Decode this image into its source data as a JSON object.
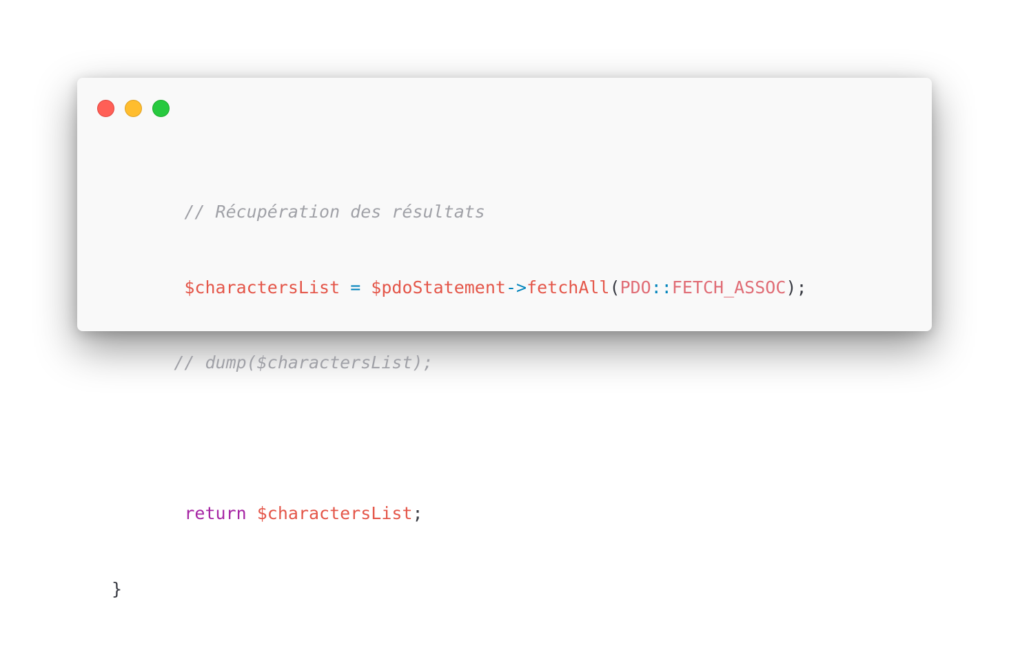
{
  "window": {
    "controls": [
      "close",
      "minimize",
      "maximize"
    ],
    "colors": {
      "background": "#f9f9f9",
      "close": "#ff5f56",
      "minimize": "#ffbd2e",
      "maximize": "#27c93f"
    }
  },
  "code": {
    "language": "php",
    "lines": [
      {
        "indent": "       ",
        "comment": "// Récupération des résultats"
      },
      {
        "indent": "       ",
        "var1": "$charactersList",
        "eq": " = ",
        "var2": "$pdoStatement",
        "arrow": "->",
        "method": "fetchAll",
        "open": "(",
        "cls": "PDO",
        "scope": "::",
        "constant": "FETCH_ASSOC",
        "close": ");"
      },
      {
        "indent": "      ",
        "comment": "// dump($charactersList);"
      },
      {
        "indent": ""
      },
      {
        "indent": "       ",
        "keyword": "return",
        "space": " ",
        "var": "$charactersList",
        "semi": ";"
      },
      {
        "text": "}"
      }
    ],
    "colors": {
      "comment": "#a0a1a7",
      "variable": "#e45649",
      "operator": "#0184bc",
      "keyword": "#a626a4",
      "constant": "#e06c75",
      "text": "#383a42"
    }
  }
}
